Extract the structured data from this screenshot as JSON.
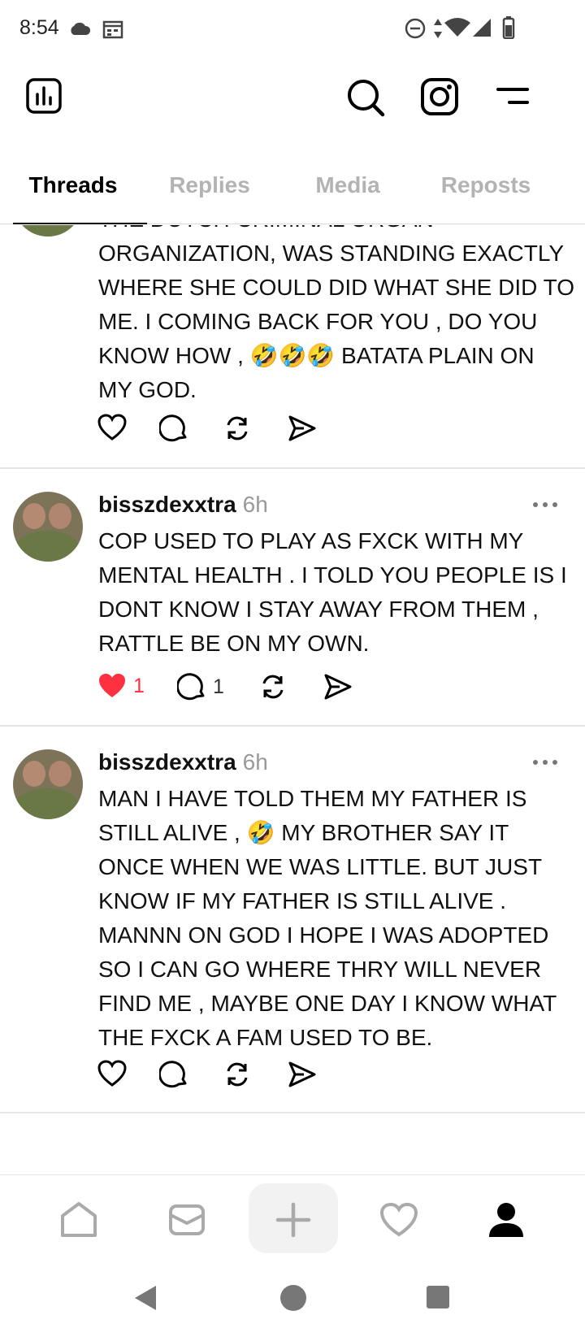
{
  "status_bar": {
    "time": "8:54",
    "icons": [
      "cloud-icon",
      "calendar-icon",
      "do-not-disturb-icon",
      "data-arrows-icon",
      "wifi-icon",
      "signal-icon",
      "battery-icon"
    ]
  },
  "toolbar": {
    "icons": [
      "insights-icon",
      "search-icon",
      "instagram-icon",
      "menu-icon"
    ]
  },
  "tabs": [
    {
      "label": "Threads",
      "active": true
    },
    {
      "label": "Replies",
      "active": false
    },
    {
      "label": "Media",
      "active": false
    },
    {
      "label": "Reposts",
      "active": false
    }
  ],
  "posts": [
    {
      "username": "",
      "time": "",
      "text_lines": [
        "THE DUTCH CRIMINAL ORGAN",
        "ORGANIZATION, WAS STANDING EXACTLY",
        "WHERE SHE COULD DID WHAT SHE DID TO",
        "ME. I COMING BACK FOR YOU , DO YOU",
        "KNOW HOW , 🤣🤣🤣 BATATA PLAIN ON",
        "MY GOD."
      ],
      "likes": "",
      "replies": "",
      "liked": false
    },
    {
      "username": "bisszdexxtra",
      "time": "6h",
      "text_lines": [
        "COP USED TO PLAY AS FXCK WITH MY",
        "MENTAL HEALTH . I TOLD YOU PEOPLE IS I",
        "DONT KNOW I STAY AWAY FROM THEM ,",
        "RATTLE BE ON MY OWN."
      ],
      "likes": "1",
      "replies": "1",
      "liked": true
    },
    {
      "username": "bisszdexxtra",
      "time": "6h",
      "text_lines": [
        "MAN I HAVE TOLD THEM MY FATHER IS",
        "STILL ALIVE , 🤣 MY BROTHER SAY IT",
        "ONCE WHEN WE WAS LITTLE. BUT JUST",
        "KNOW IF MY FATHER IS STILL ALIVE .",
        "MANNN ON GOD I HOPE I WAS ADOPTED",
        "SO I CAN GO WHERE THRY WILL NEVER",
        "FIND ME , MAYBE ONE DAY I KNOW WHAT",
        "THE FXCK A FAM USED TO BE."
      ],
      "likes": "",
      "replies": "",
      "liked": false
    }
  ],
  "bottom_nav": {
    "items": [
      "home-icon",
      "inbox-icon",
      "create-icon",
      "activity-icon",
      "profile-icon"
    ],
    "active": "profile-icon"
  },
  "colors": {
    "like_red": "#ff3040",
    "inactive_tab": "#b3b3b3",
    "divider": "#e6e6e6"
  }
}
